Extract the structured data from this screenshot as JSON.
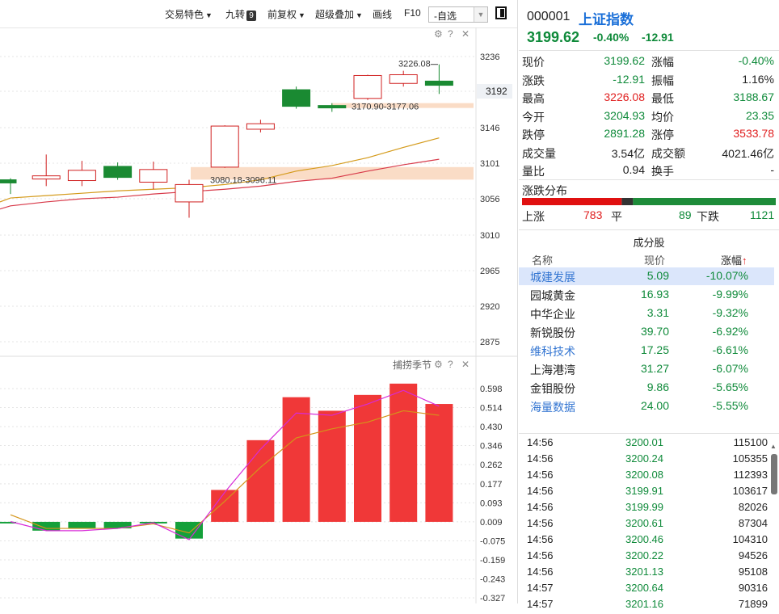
{
  "toolbar": {
    "items": [
      "交易特色",
      "九转",
      "前复权",
      "超级叠加",
      "画线",
      "F10"
    ],
    "nine_badge": "9",
    "select_value": "-自选"
  },
  "chart": {
    "price_axis": [
      "3236",
      "3192",
      "3146",
      "3101",
      "3056",
      "3010",
      "2965",
      "2920",
      "2875"
    ],
    "current_price_label": "3192",
    "annotations": [
      "3226.08",
      "3170.90-3177.06",
      "3080.18-3096.11"
    ],
    "oscillator_title": "捕捞季节",
    "osc_axis": [
      "0.598",
      "0.514",
      "0.430",
      "0.346",
      "0.262",
      "0.177",
      "0.093",
      "0.009",
      "-0.075",
      "-0.159",
      "-0.243",
      "-0.327"
    ],
    "candles": [
      {
        "open": 3080.0,
        "close": 3076.0,
        "high": 3082.0,
        "low": 3062.0
      },
      {
        "open": 3081.0,
        "close": 3085.0,
        "high": 3112.0,
        "low": 3072.0
      },
      {
        "open": 3079.0,
        "close": 3092.0,
        "high": 3104.0,
        "low": 3072.0
      },
      {
        "open": 3097.0,
        "close": 3083.0,
        "high": 3102.0,
        "low": 3080.0
      },
      {
        "open": 3077.0,
        "close": 3093.0,
        "high": 3103.0,
        "low": 3068.0
      },
      {
        "open": 3052.0,
        "close": 3074.0,
        "high": 3080.0,
        "low": 3032.0
      },
      {
        "open": 3096.0,
        "close": 3148.0,
        "high": 3149.0,
        "low": 3095.0
      },
      {
        "open": 3144.0,
        "close": 3151.0,
        "high": 3156.0,
        "low": 3140.0
      },
      {
        "open": 3194.0,
        "close": 3173.0,
        "high": 3198.0,
        "low": 3170.0
      },
      {
        "open": 3174.0,
        "close": 3171.0,
        "high": 3177.0,
        "low": 3166.0
      },
      {
        "open": 3183.0,
        "close": 3212.0,
        "high": 3213.0,
        "low": 3181.0
      },
      {
        "open": 3202.0,
        "close": 3213.0,
        "high": 3218.0,
        "low": 3198.0
      },
      {
        "open": 3204.93,
        "close": 3199.62,
        "high": 3226.08,
        "low": 3188.67
      }
    ],
    "ma_orange": [
      3057,
      3060,
      3063,
      3066,
      3068,
      3070,
      3074,
      3080,
      3091,
      3098,
      3108,
      3121,
      3133
    ],
    "ma_red": [
      3047,
      3052,
      3056,
      3058,
      3062,
      3065,
      3068,
      3072,
      3078,
      3082,
      3091,
      3099,
      3106
    ],
    "bands": [
      {
        "low": 3080.18,
        "high": 3096.11
      },
      {
        "low": 3170.9,
        "high": 3177.06
      }
    ],
    "osc_bars": [
      0.005,
      -0.03,
      -0.02,
      -0.02,
      0.003,
      -0.065,
      0.15,
      0.37,
      0.56,
      0.5,
      0.57,
      0.62,
      0.53
    ],
    "osc_orange": [
      0.04,
      -0.02,
      -0.02,
      -0.02,
      0.0,
      -0.04,
      0.1,
      0.25,
      0.38,
      0.42,
      0.45,
      0.5,
      0.48
    ],
    "osc_magenta": [
      0.01,
      -0.03,
      -0.03,
      -0.02,
      0.005,
      -0.07,
      0.14,
      0.33,
      0.49,
      0.48,
      0.53,
      0.59,
      0.52
    ]
  },
  "quote": {
    "code": "000001",
    "name": "上证指数",
    "price": "3199.62",
    "pct": "-0.40%",
    "change": "-12.91",
    "rows": [
      {
        "l1": "现价",
        "v1": "3199.62",
        "c1": "green",
        "l2": "涨幅",
        "v2": "-0.40%",
        "c2": "green"
      },
      {
        "l1": "涨跌",
        "v1": "-12.91",
        "c1": "green",
        "l2": "振幅",
        "v2": "1.16%",
        "c2": "dark"
      },
      {
        "l1": "最高",
        "v1": "3226.08",
        "c1": "red",
        "l2": "最低",
        "v2": "3188.67",
        "c2": "green"
      },
      {
        "l1": "今开",
        "v1": "3204.93",
        "c1": "green",
        "l2": "均价",
        "v2": "23.35",
        "c2": "green"
      },
      {
        "l1": "跌停",
        "v1": "2891.28",
        "c1": "green",
        "l2": "涨停",
        "v2": "3533.78",
        "c2": "red"
      },
      {
        "l1": "成交量",
        "v1": "3.54亿",
        "c1": "dark",
        "l2": "成交额",
        "v2": "4021.46亿",
        "c2": "dark"
      },
      {
        "l1": "量比",
        "v1": "0.94",
        "c1": "dark",
        "l2": "换手",
        "v2": "-",
        "c2": "dark"
      }
    ],
    "dist_title": "涨跌分布",
    "up_label": "上涨",
    "up_count": "783",
    "flat_label": "平",
    "flat_count": "89",
    "down_label": "下跌",
    "down_count": "1121",
    "up_color": "#e01010",
    "flat_color": "#333333",
    "down_color": "#1e8c3a"
  },
  "components": {
    "title": "成分股",
    "headers": {
      "name": "名称",
      "price": "现价",
      "change": "涨幅",
      "sort_arrow": "↑"
    },
    "rows": [
      {
        "name": "城建发展",
        "price": "5.09",
        "change": "-10.07%",
        "link": true
      },
      {
        "name": "园城黄金",
        "price": "16.93",
        "change": "-9.99%",
        "link": false
      },
      {
        "name": "中华企业",
        "price": "3.31",
        "change": "-9.32%",
        "link": false
      },
      {
        "name": "新锐股份",
        "price": "39.70",
        "change": "-6.92%",
        "link": false
      },
      {
        "name": "维科技术",
        "price": "17.25",
        "change": "-6.61%",
        "link": true
      },
      {
        "name": "上海港湾",
        "price": "31.27",
        "change": "-6.07%",
        "link": false
      },
      {
        "name": "金钼股份",
        "price": "9.86",
        "change": "-5.65%",
        "link": false
      },
      {
        "name": "海量数据",
        "price": "24.00",
        "change": "-5.55%",
        "link": true
      }
    ]
  },
  "ticks": [
    {
      "time": "14:56",
      "price": "3200.01",
      "vol": "115100"
    },
    {
      "time": "14:56",
      "price": "3200.24",
      "vol": "105355"
    },
    {
      "time": "14:56",
      "price": "3200.08",
      "vol": "112393"
    },
    {
      "time": "14:56",
      "price": "3199.91",
      "vol": "103617"
    },
    {
      "time": "14:56",
      "price": "3199.99",
      "vol": "82026"
    },
    {
      "time": "14:56",
      "price": "3200.61",
      "vol": "87304"
    },
    {
      "time": "14:56",
      "price": "3200.46",
      "vol": "104310"
    },
    {
      "time": "14:56",
      "price": "3200.22",
      "vol": "94526"
    },
    {
      "time": "14:56",
      "price": "3201.13",
      "vol": "95108"
    },
    {
      "time": "14:57",
      "price": "3200.64",
      "vol": "90316"
    },
    {
      "time": "14:57",
      "price": "3201.16",
      "vol": "71899"
    }
  ]
}
